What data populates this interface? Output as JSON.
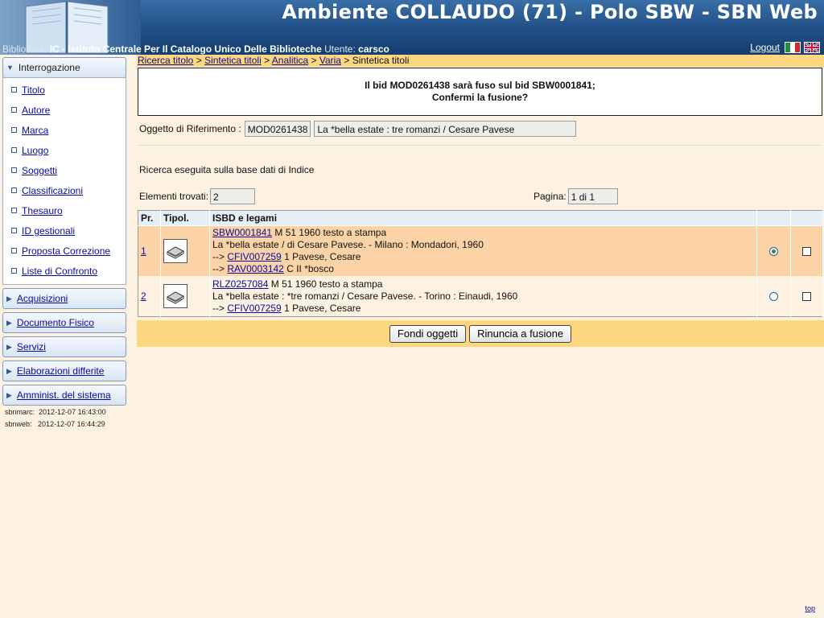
{
  "header": {
    "title": "Ambiente COLLAUDO (71) - Polo SBW - SBN Web",
    "biblioteca_label": "Biblioteca:",
    "biblioteca_value": "IC - Istituto Centrale Per Il Catalogo Unico Delle Biblioteche",
    "utente_label": "Utente:",
    "utente_value": "carsco",
    "logout_label": "Logout"
  },
  "sidebar": {
    "open_section": "Interrogazione",
    "items": [
      "Titolo",
      "Autore",
      "Marca",
      "Luogo",
      "Soggetti",
      "Classificazioni",
      "Thesauro",
      "ID gestionali",
      "Proposta Correzione",
      "Liste di Confronto"
    ],
    "sections": [
      "Acquisizioni",
      "Documento Fisico",
      "Servizi",
      "Elaborazioni differite",
      "Amminist. del sistema"
    ],
    "sbnmarc_label": "sbnmarc:",
    "sbnmarc_time": "2012-12-07 16:43:00",
    "sbnweb_label": "sbnweb:",
    "sbnweb_time": "2012-12-07 16:44:29"
  },
  "breadcrumb": {
    "links": [
      "Ricerca titolo",
      "Sintetica titoli",
      "Analitica",
      "Varia"
    ],
    "current": "Sintetica titoli",
    "separator": ">"
  },
  "message": {
    "line1": "Il bid MOD0261438 sarà fuso sul bid SBW0001841;",
    "line2": "Confermi la fusione?"
  },
  "oggetto": {
    "label": "Oggetto di Riferimento :",
    "bid": "MOD0261438",
    "title": "La *bella estate : tre romanzi / Cesare Pavese"
  },
  "ricerca_text": "Ricerca eseguita sulla base dati di Indice",
  "elementi": {
    "label": "Elementi trovati:",
    "value": "2"
  },
  "pagina": {
    "label": "Pagina:",
    "value": "1 di 1"
  },
  "table": {
    "headers": [
      "Pr.",
      "Tipol.",
      "ISBD e legami",
      "",
      ""
    ],
    "rows": [
      {
        "pr": "1",
        "bid": "SBW0001841",
        "bid_rest": "M 51 1960 testo a stampa",
        "isbd": "La *bella estate / di Cesare Pavese. - Milano : Mondadori, 1960",
        "link1_prefix": "-->",
        "link1_id": "CFIV007259",
        "link1_rest": "1 Pavese, Cesare",
        "link2_prefix": "-->",
        "link2_id": "RAV0003142",
        "link2_rest": "C II *bosco",
        "radio_selected": true,
        "checked": false
      },
      {
        "pr": "2",
        "bid": "RLZ0257084",
        "bid_rest": "M 51 1960 testo a stampa",
        "isbd": "La *bella estate : *tre romanzi / Cesare Pavese. - Torino : Einaudi, 1960",
        "link1_prefix": "-->",
        "link1_id": "CFIV007259",
        "link1_rest": "1 Pavese, Cesare",
        "radio_selected": false,
        "checked": false
      }
    ]
  },
  "buttons": {
    "fondi": "Fondi oggetti",
    "rinuncia": "Rinuncia a fusione"
  },
  "toplink": "top"
}
